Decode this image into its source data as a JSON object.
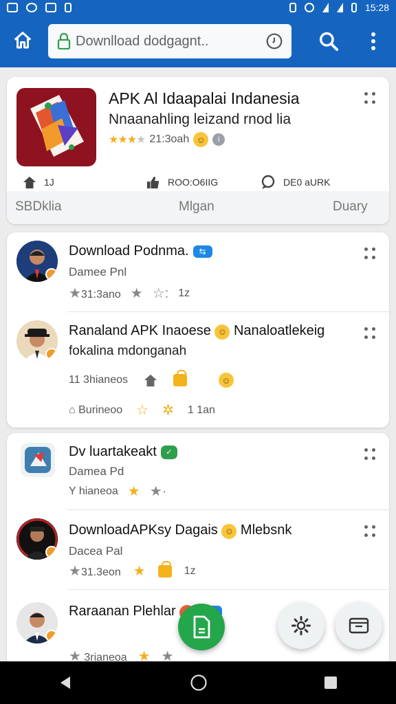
{
  "status_bar": {
    "time": "15:28"
  },
  "app_bar": {
    "url": "Downlload dodgagnt.."
  },
  "hero": {
    "title": "APK Al Idaapalai Indanesia",
    "subtitle": "Nnaanahling leizand rnod lia",
    "rating_text": "21:3oah",
    "stats": [
      "1J",
      "ROO:O6IIG",
      "DE0 aURK"
    ],
    "footer": [
      "SBDklia",
      "Mlgan",
      "Duary"
    ]
  },
  "list_card_2": [
    {
      "title": "Download Podnma.",
      "subtitle": "Damee Pnl",
      "meta": "31:3ano",
      "meta_tail": "1z"
    },
    {
      "title": "Ranaland APK Inaoese",
      "title_tail": "Nanaloatlekeig",
      "subtitle": "fokalina mdonganah",
      "meta": "11 3hianeos",
      "meta2": "Burineoo",
      "meta2_tail": "1 1an"
    }
  ],
  "list_card_3": [
    {
      "title": "Dv luartakeakt",
      "subtitle": "Damea Pd",
      "meta": "Y hianeoa"
    },
    {
      "title": "DownloadAPKsy Dagais",
      "title_tail": "Mlebsnk",
      "subtitle": "Dacea Pal",
      "meta": "31.3eon",
      "meta_tail": "1z"
    },
    {
      "title": "Raraanan Plehlar",
      "meta": "3rianeoa"
    }
  ],
  "colors": {
    "primary": "#1565c0",
    "fab": "#24a64b",
    "star": "#f2b01e",
    "badge": "#f29b2a"
  },
  "icons": [
    "home-icon",
    "lock-icon",
    "clock-icon",
    "search-icon",
    "more-vert-icon",
    "document-icon",
    "settings-gear-icon",
    "folder-icon",
    "back-icon",
    "home-circle-icon",
    "recents-icon"
  ]
}
